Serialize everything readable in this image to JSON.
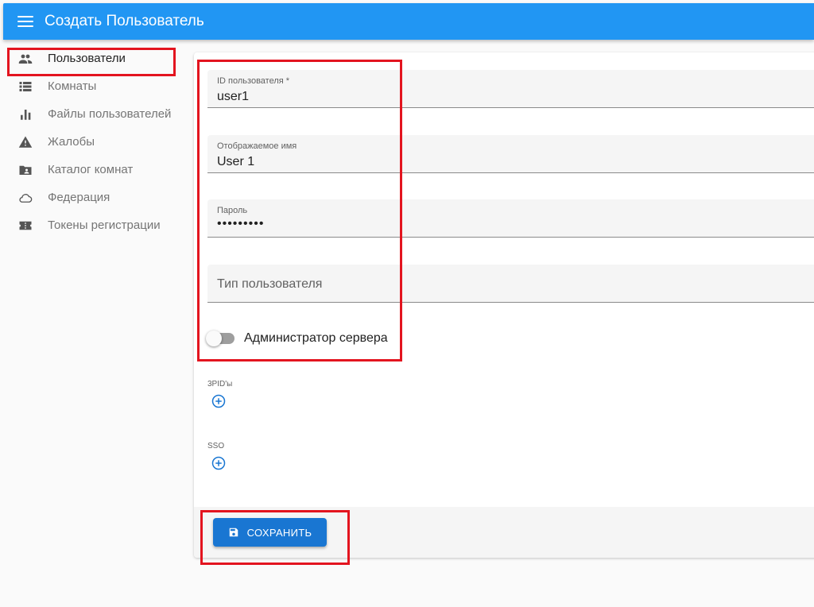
{
  "appbar": {
    "title": "Создать Пользователь",
    "menu_icon": "menu-icon"
  },
  "sidebar": {
    "items": [
      {
        "label": "Пользователи",
        "icon": "people-icon",
        "active": true
      },
      {
        "label": "Комнаты",
        "icon": "list-icon"
      },
      {
        "label": "Файлы пользователей",
        "icon": "bar-chart-icon"
      },
      {
        "label": "Жалобы",
        "icon": "warning-icon"
      },
      {
        "label": "Каталог комнат",
        "icon": "folder-shared-icon"
      },
      {
        "label": "Федерация",
        "icon": "cloud-icon"
      },
      {
        "label": "Токены регистрации",
        "icon": "ticket-icon"
      }
    ]
  },
  "form": {
    "user_id": {
      "label": "ID пользователя *",
      "value": "user1"
    },
    "display_name": {
      "label": "Отображаемое имя",
      "value": "User 1"
    },
    "password": {
      "label": "Пароль",
      "value": "•••••••••"
    },
    "user_type": {
      "placeholder": "Тип пользователя"
    },
    "admin_switch": {
      "label": "Администратор сервера",
      "checked": false
    },
    "threepids": {
      "label": "3PID'ы",
      "add_icon": "add-circle-icon"
    },
    "sso": {
      "label": "SSO",
      "add_icon": "add-circle-icon"
    }
  },
  "toolbar": {
    "save_label": "СОХРАНИТЬ",
    "save_icon": "save-icon"
  },
  "colors": {
    "appbar": "#2196f3",
    "primary_button": "#1976d2",
    "highlight": "#e3141f"
  }
}
